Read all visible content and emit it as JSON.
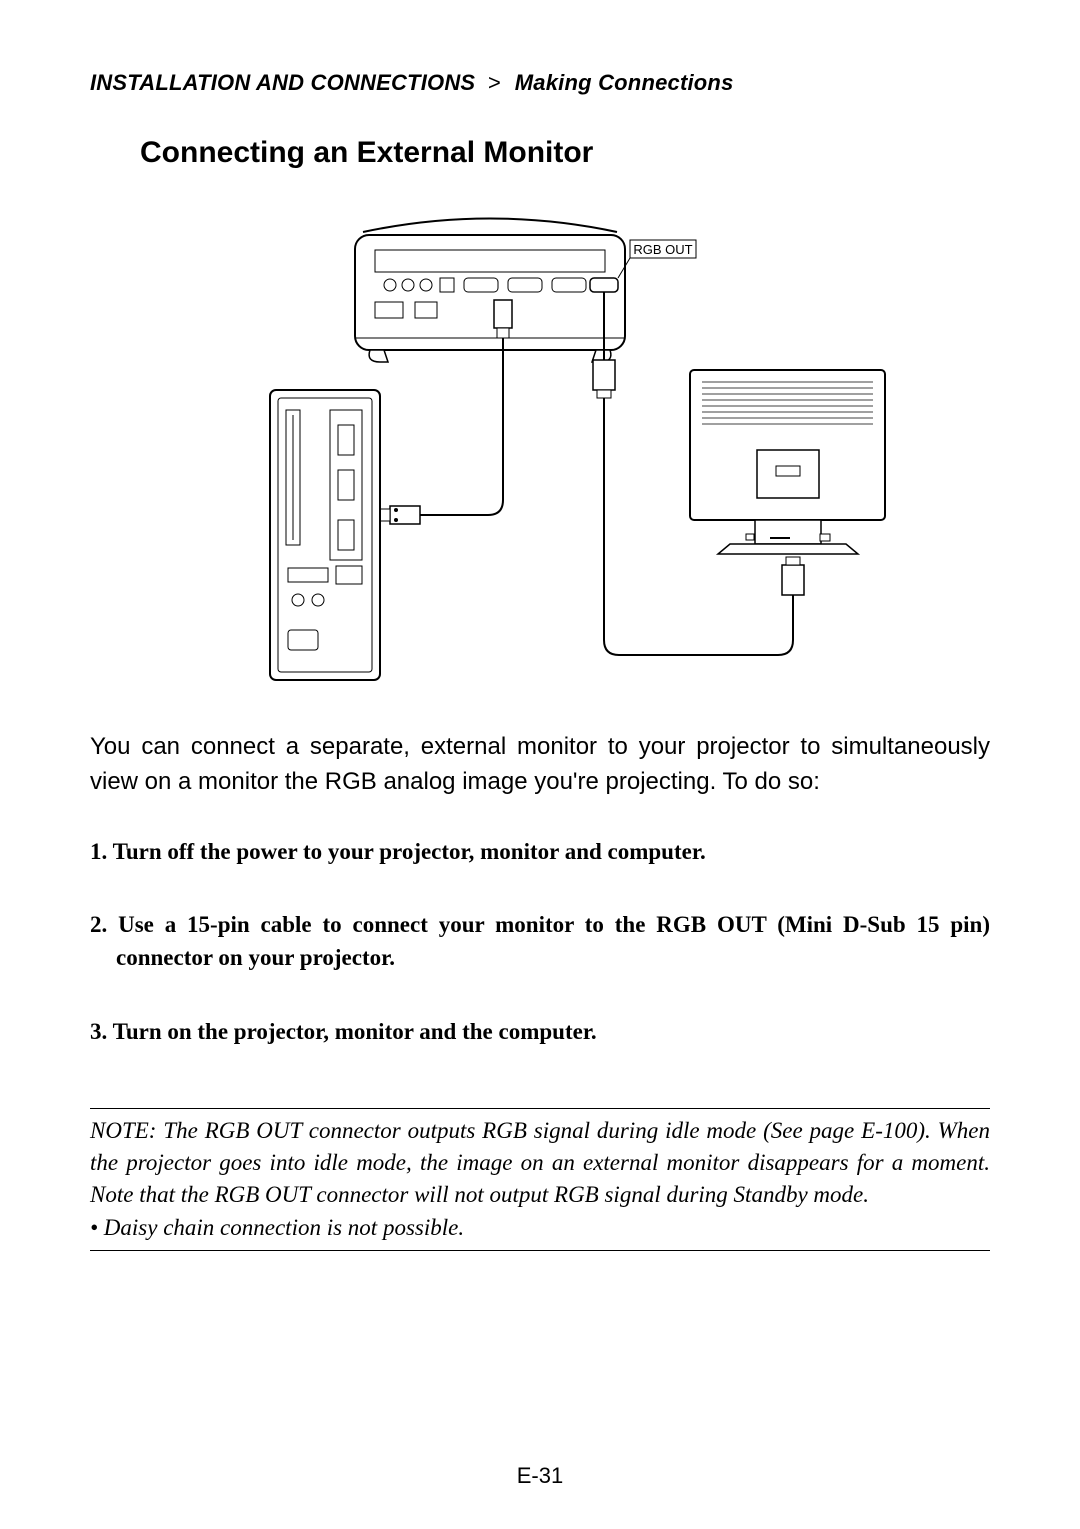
{
  "breadcrumb": {
    "section": "INSTALLATION AND CONNECTIONS",
    "sep": ">",
    "sub": "Making Connections"
  },
  "title": "Connecting an External Monitor",
  "diagram_label": "RGB OUT",
  "intro": "You can connect a separate, external monitor to your projector to simultaneously view on a monitor the RGB analog image you're projecting. To do so:",
  "steps": [
    "1. Turn off the power to your projector, monitor and computer.",
    "2. Use a 15-pin cable to connect your monitor to the RGB OUT (Mini D-Sub 15 pin) connector on your projector.",
    "3. Turn on the projector, monitor and the computer."
  ],
  "note_main": "NOTE: The RGB OUT connector outputs RGB signal during idle mode (See page E-100). When the projector goes into idle mode, the image on an external monitor disappears for a moment. Note that the RGB OUT connector will not output RGB signal during Standby mode.",
  "note_bullet": "• Daisy chain connection is not possible.",
  "page_number": "E-31"
}
